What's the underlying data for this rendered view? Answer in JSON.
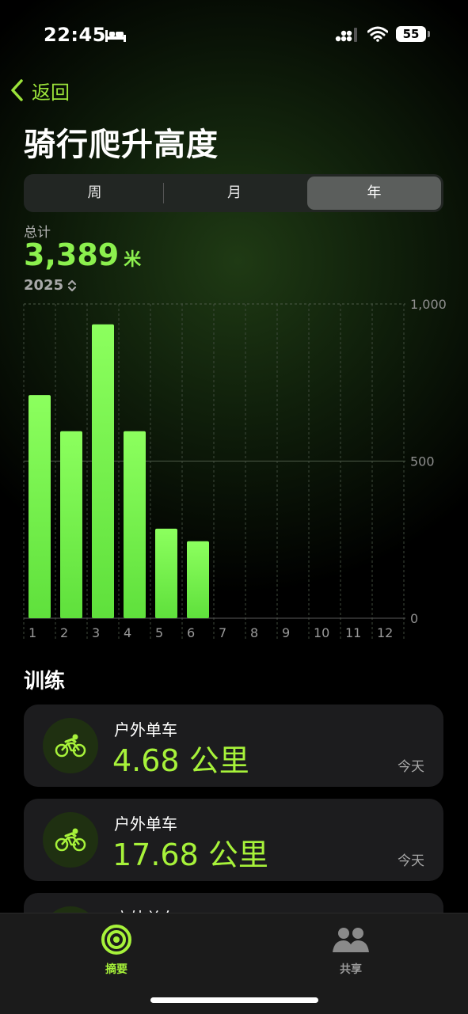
{
  "status_bar": {
    "time": "22:45",
    "battery": "55"
  },
  "nav": {
    "back_label": "返回"
  },
  "page": {
    "title": "骑行爬升高度"
  },
  "segmented": {
    "options": [
      "周",
      "月",
      "年"
    ],
    "selected": "年"
  },
  "summary": {
    "label": "总计",
    "value": "3,389",
    "unit": "米",
    "year": "2025"
  },
  "colors": {
    "accent": "#8cf04e",
    "bar": "#6ef04a",
    "background": "#000000"
  },
  "chart_data": {
    "type": "bar",
    "categories": [
      "1",
      "2",
      "3",
      "4",
      "5",
      "6",
      "7",
      "8",
      "9",
      "10",
      "11",
      "12"
    ],
    "values": [
      710,
      595,
      935,
      595,
      285,
      245,
      0,
      0,
      0,
      0,
      0,
      0
    ],
    "ylim": [
      0,
      1000
    ],
    "yticks": [
      "0",
      "500",
      "1,000"
    ],
    "grid": true,
    "axis_position": "right"
  },
  "section": {
    "title": "训练"
  },
  "workouts": [
    {
      "type": "户外单车",
      "distance": "4.68 公里",
      "day": "今天",
      "icon": "cycling-icon"
    },
    {
      "type": "户外单车",
      "distance": "17.68 公里",
      "day": "今天",
      "icon": "cycling-icon"
    },
    {
      "type": "户外单车",
      "distance": "",
      "day": "",
      "icon": "cycling-icon"
    }
  ],
  "tabs": [
    {
      "label": "摘要",
      "icon": "activity-rings-icon",
      "active": true
    },
    {
      "label": "共享",
      "icon": "people-icon",
      "active": false
    }
  ]
}
